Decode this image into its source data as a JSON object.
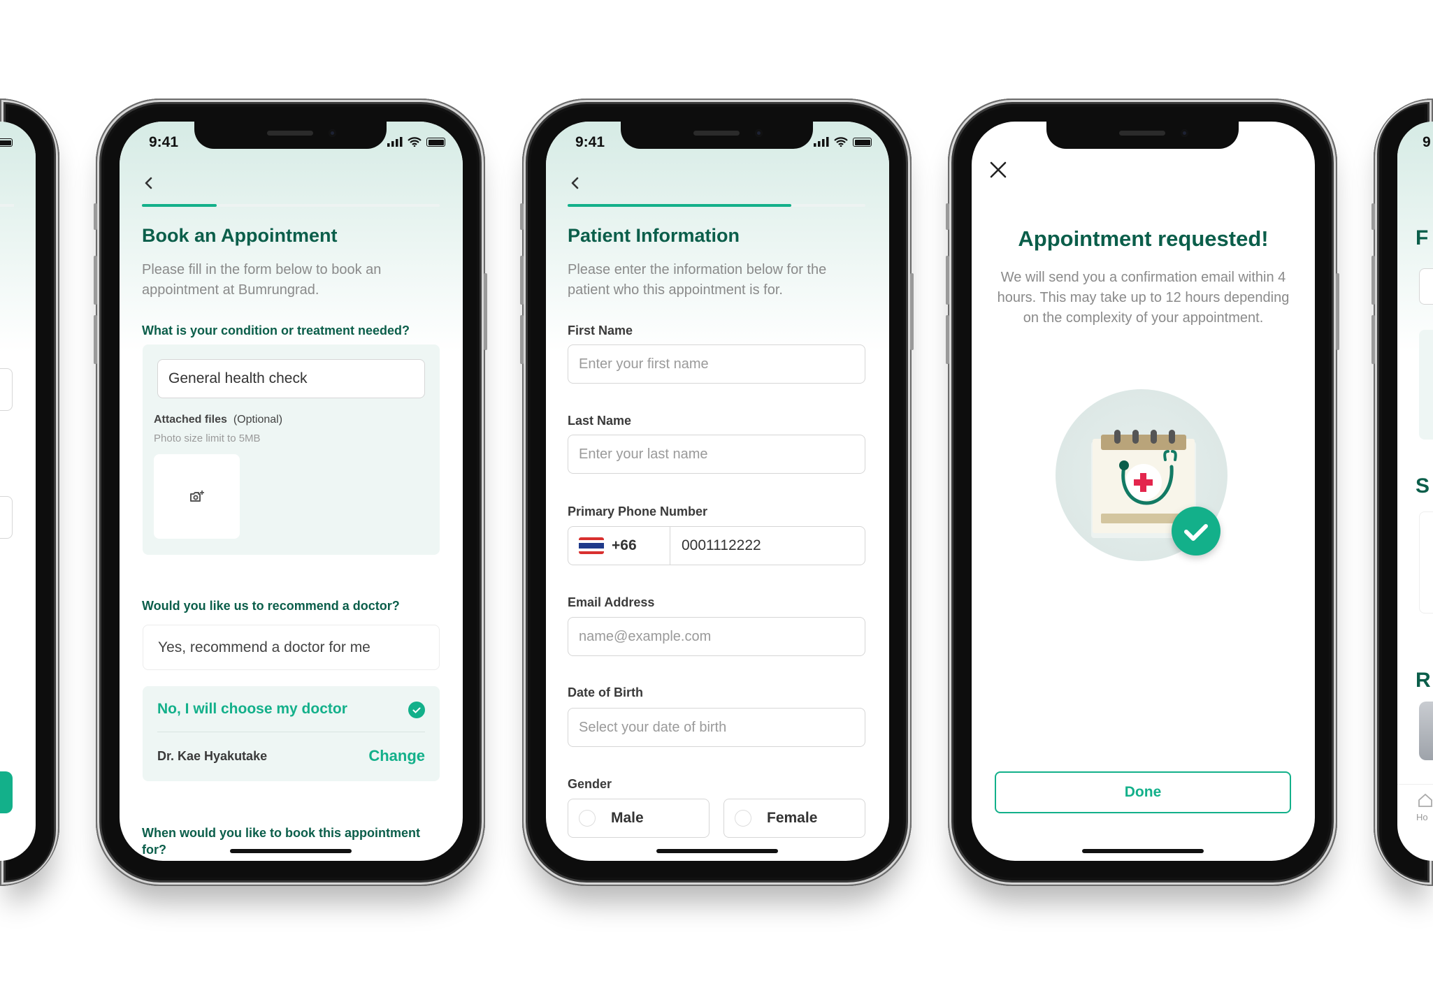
{
  "status_bar": {
    "time": "9:41"
  },
  "colors": {
    "brand_dark": "#0b5e4a",
    "accent": "#13b08a",
    "panel": "#eef6f4"
  },
  "icons": {
    "back": "chevron-left-icon",
    "close": "close-icon",
    "camera": "camera-add-icon",
    "check": "check-circle-icon",
    "flag": "thailand-flag-icon"
  },
  "screen_book": {
    "progress_percent": 25,
    "title": "Book an Appointment",
    "description": "Please fill in the form below to book an appointment at Bumrungrad.",
    "condition_question": "What is your condition or treatment needed?",
    "condition_value": "General health check",
    "attached_label": "Attached files",
    "attached_optional": "(Optional)",
    "photo_limit": "Photo size limit to 5MB",
    "doctor_question": "Would you like us to recommend a doctor?",
    "option_recommend": "Yes, recommend a doctor for me",
    "option_choose": "No, I will choose my doctor",
    "option_choose_selected": true,
    "doctor_name": "Dr. Kae Hyakutake",
    "change_label": "Change",
    "when_question": "When would you like to book this appointment for?"
  },
  "screen_patient": {
    "progress_percent": 75,
    "title": "Patient Information",
    "description": "Please enter the information below for the patient who this appointment is for.",
    "first_name_label": "First Name",
    "first_name_placeholder": "Enter your first name",
    "last_name_label": "Last Name",
    "last_name_placeholder": "Enter your last name",
    "phone_label": "Primary Phone Number",
    "phone_code": "+66",
    "phone_value": "0001112222",
    "email_label": "Email Address",
    "email_placeholder": "name@example.com",
    "dob_label": "Date of Birth",
    "dob_placeholder": "Select your date of birth",
    "gender_label": "Gender",
    "gender_male": "Male",
    "gender_female": "Female"
  },
  "screen_done": {
    "title": "Appointment requested!",
    "message": "We will send you a confirmation email within 4 hours. This may take up to 12 hours depending on the complexity of your appointment.",
    "done_label": "Done"
  },
  "screen_next": {
    "time": "9",
    "heading1": "F",
    "heading2": "S",
    "heading3": "R",
    "nav_home": "Ho"
  }
}
